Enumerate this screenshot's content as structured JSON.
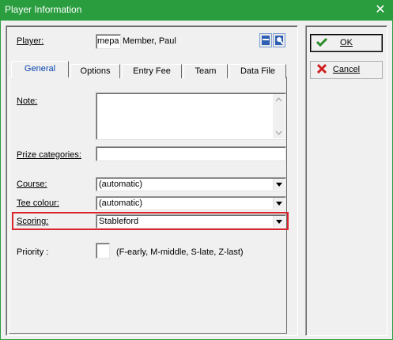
{
  "window": {
    "title": "Player Information",
    "close_symbol": "✕"
  },
  "player": {
    "label": "Player:",
    "code": "mepa",
    "name": "Member, Paul"
  },
  "tabs": [
    {
      "label": "General",
      "active": true
    },
    {
      "label": "Options",
      "active": false
    },
    {
      "label": "Entry Fee",
      "active": false
    },
    {
      "label": "Team",
      "active": false
    },
    {
      "label": "Data File",
      "active": false
    }
  ],
  "fields": {
    "note_label": "Note:",
    "note_value": "",
    "prize_label": "Prize categories:",
    "prize_value": "",
    "course_label": "Course:",
    "course_value": "(automatic)",
    "tee_label": "Tee colour:",
    "tee_value": "(automatic)",
    "scoring_label": "Scoring:",
    "scoring_value": "Stableford",
    "priority_label": "Priority :",
    "priority_value": "",
    "priority_hint": "(F-early, M-middle, S-late, Z-last)"
  },
  "buttons": {
    "ok": "OK",
    "cancel": "Cancel"
  },
  "colors": {
    "titlebar": "#2a9d3f",
    "highlight": "#d9242b",
    "ok_check": "#2b8a2b",
    "cancel_x": "#d11f1f",
    "active_tab": "#0645ad"
  }
}
